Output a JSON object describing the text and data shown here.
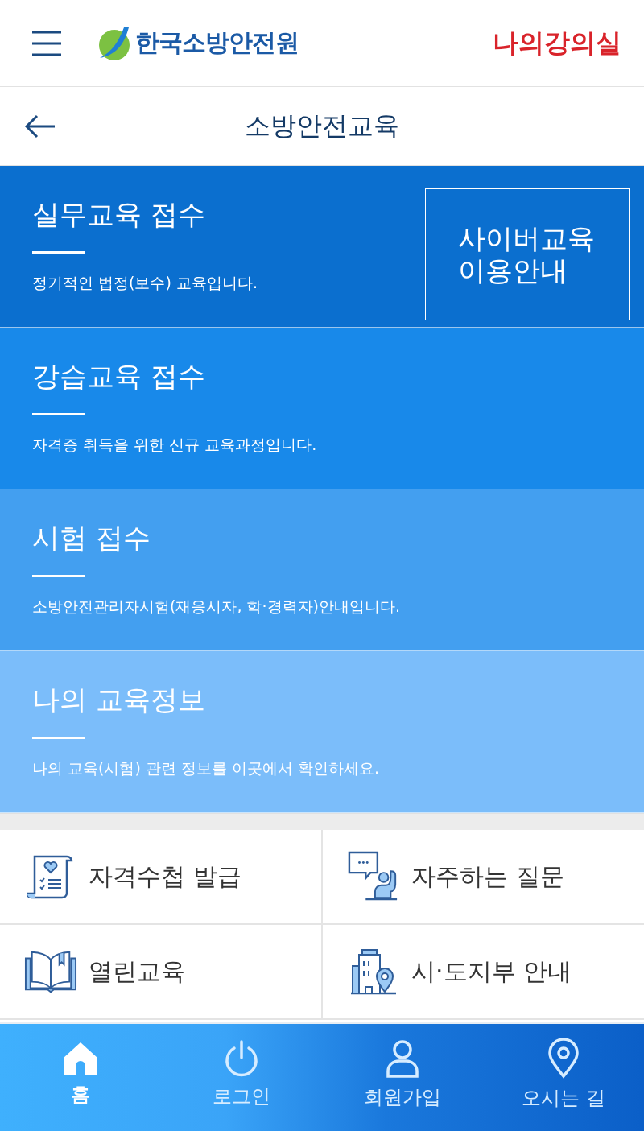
{
  "header": {
    "logo_text": "한국소방안전원",
    "my_classroom_link": "나의강의실"
  },
  "page_title": "소방안전교육",
  "sections": [
    {
      "title": "실무교육 접수",
      "description": "정기적인 법정(보수) 교육입니다.",
      "color": "#0b6fcf",
      "side_button": "사이버교육\n이용안내"
    },
    {
      "title": "강습교육 접수",
      "description": "자격증 취득을 위한 신규 교육과정입니다.",
      "color": "#1889ea"
    },
    {
      "title": "시험 접수",
      "description": "소방안전관리자시험(재응시자, 학·경력자)안내입니다.",
      "color": "#439ff0"
    },
    {
      "title": "나의 교육정보",
      "description": "나의 교육(시험) 관련 정보를 이곳에서 확인하세요.",
      "color": "#7bbdfa"
    }
  ],
  "quick_links": [
    {
      "kind": "certificate",
      "label": "자격수첩 발급"
    },
    {
      "kind": "faq",
      "label": "자주하는 질문"
    },
    {
      "kind": "book",
      "label": "열린교육"
    },
    {
      "kind": "branch",
      "label": "시·도지부 안내"
    }
  ],
  "bottom_nav": [
    {
      "kind": "home",
      "label": "홈",
      "selected": true
    },
    {
      "kind": "power",
      "label": "로그인",
      "selected": false
    },
    {
      "kind": "person",
      "label": "회원가입",
      "selected": false
    },
    {
      "kind": "pin",
      "label": "오시는 길",
      "selected": false
    }
  ]
}
